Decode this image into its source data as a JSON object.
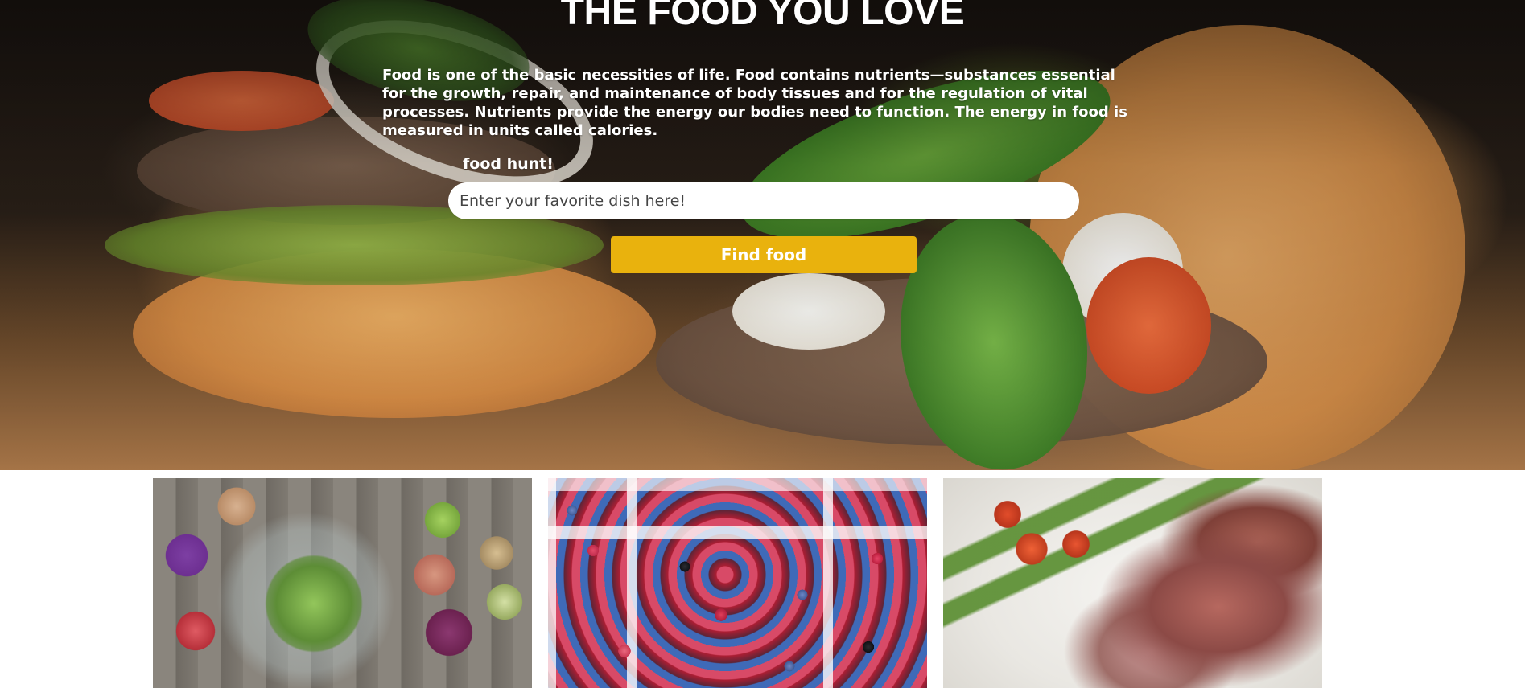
{
  "hero": {
    "title": "THE FOOD YOU LOVE",
    "description": "Food is one of the basic necessities of life. Food contains nutrients—substances essential for the growth, repair, and maintenance of body tissues and for the regulation of vital processes. Nutrients provide the energy our bodies need to function. The energy in food is measured in units called calories.",
    "search_label": "food hunt!",
    "search_placeholder": "Enter your favorite dish here!",
    "search_value": "",
    "button_label": "Find food"
  },
  "colors": {
    "button": "#e9b20d",
    "hero_text": "#ffffff",
    "input_bg": "#ffffff"
  },
  "gallery": [
    {
      "name": "salad-image"
    },
    {
      "name": "berries-image"
    },
    {
      "name": "steak-image"
    }
  ]
}
